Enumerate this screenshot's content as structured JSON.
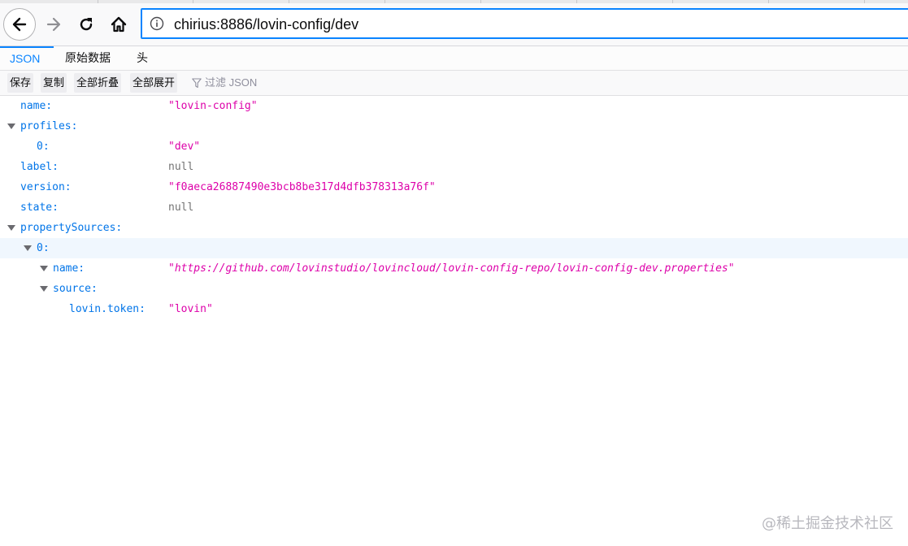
{
  "browser": {
    "url": "chirius:8886/lovin-config/dev",
    "icons": {
      "back": "back-arrow-icon",
      "forward": "forward-arrow-icon",
      "reload": "reload-icon",
      "home": "home-icon",
      "site_info": "info-icon"
    }
  },
  "viewer_tabs": [
    {
      "label": "JSON",
      "active": true
    },
    {
      "label": "原始数据",
      "active": false
    },
    {
      "label": "头",
      "active": false
    }
  ],
  "toolbar": {
    "save": "保存",
    "copy": "复制",
    "collapse_all": "全部折叠",
    "expand_all": "全部展开",
    "filter_placeholder": "过滤 JSON",
    "filter_icon": "filter-icon"
  },
  "json": {
    "name_key": "name:",
    "name_val": "\"lovin-config\"",
    "profiles_key": "profiles:",
    "profiles_0_key": "0:",
    "profiles_0_val": "\"dev\"",
    "label_key": "label:",
    "label_val": "null",
    "version_key": "version:",
    "version_val": "\"f0aeca26887490e3bcb8be317d4dfb378313a76f\"",
    "state_key": "state:",
    "state_val": "null",
    "ps_key": "propertySources:",
    "ps_0_key": "0:",
    "ps_0_name_key": "name:",
    "ps_0_name_val": "\"https://github.com/lovinstudio/lovincloud/lovin-config-repo/lovin-config-dev.properties\"",
    "ps_0_source_key": "source:",
    "token_key": "lovin.token:",
    "token_val": "\"lovin\""
  },
  "watermark": "@稀土掘金技术社区",
  "colors": {
    "key": "#0074e8",
    "string": "#dd00a9",
    "null": "#737373",
    "accent": "#0a84ff",
    "highlight_row": "#f0f7fe"
  }
}
